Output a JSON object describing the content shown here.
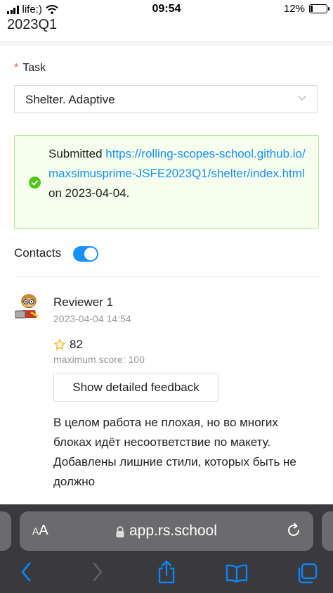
{
  "status_bar": {
    "carrier": "life:)",
    "time": "09:54",
    "battery": "12%"
  },
  "header": {
    "title": "2023Q1"
  },
  "task": {
    "required_mark": "*",
    "label": "Task",
    "selected": "Shelter. Adaptive"
  },
  "submission": {
    "prefix": "Submitted",
    "link": "https://rolling-scopes-school.github.io/maxsimusprime-JSFE2023Q1/shelter/index.html",
    "middle": "on",
    "date": "2023-04-04."
  },
  "contacts": {
    "label": "Contacts",
    "enabled": true
  },
  "review": {
    "reviewer": "Reviewer 1",
    "date": "2023-04-04 14:54",
    "score": "82",
    "max_score": "maximum score: 100",
    "feedback_button": "Show detailed feedback",
    "comment": "В целом работа не плохая, но во многих блоках идёт несоответствие по макету. Добавлены лишние стили, которых быть не должно"
  },
  "browser": {
    "aa_small": "A",
    "aa_large": "A",
    "url": "app.rs.school"
  },
  "colors": {
    "link": "#1890ff",
    "success_bg": "#f6ffed",
    "success_border": "#b7eb8f",
    "success_icon": "#52c41a",
    "toggle_on": "#1890ff",
    "required": "#ff4d4f",
    "ios_blue": "#0a84ff"
  },
  "icons": [
    "wifi-icon",
    "chevron-down-icon",
    "check-circle-icon",
    "star-icon",
    "lock-icon",
    "reload-icon",
    "back-icon",
    "forward-icon",
    "share-icon",
    "bookmarks-icon",
    "tabs-icon"
  ]
}
